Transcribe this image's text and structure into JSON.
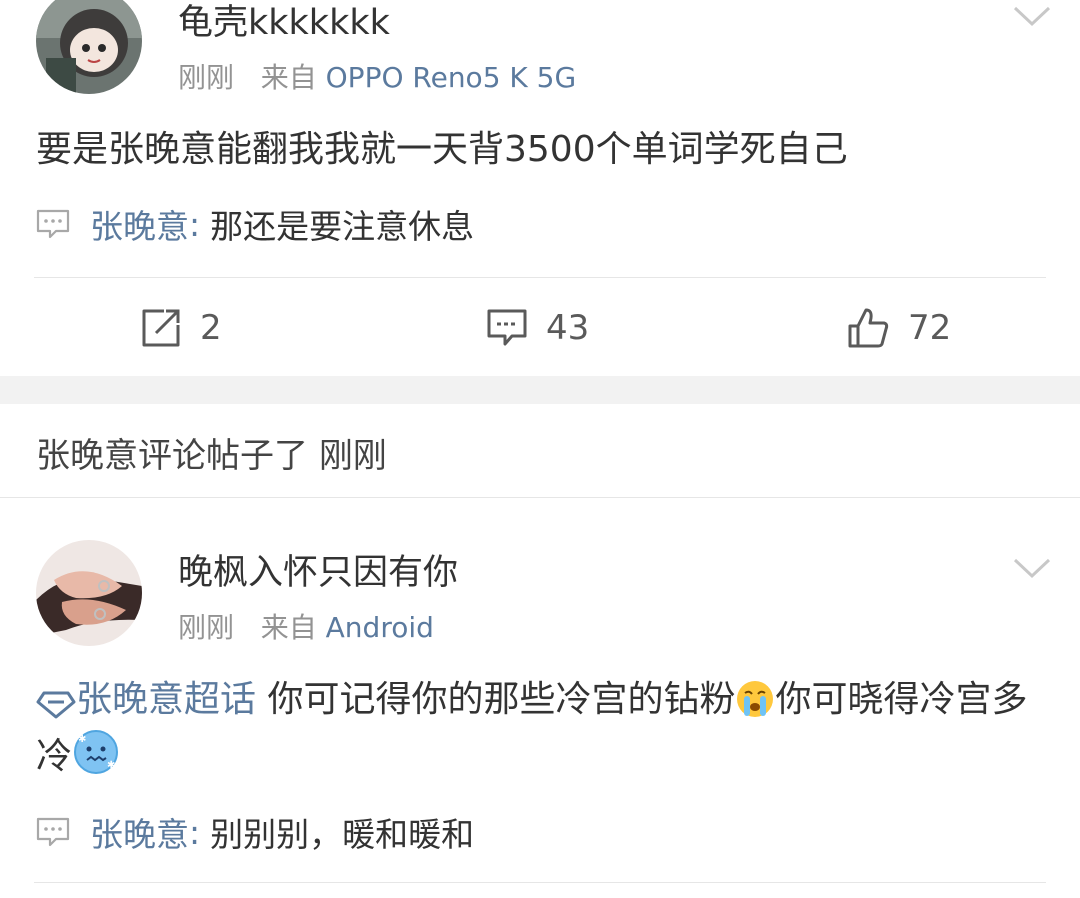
{
  "post1": {
    "username": "龟壳kkkkkkk",
    "time": "刚刚",
    "from_prefix": "来自",
    "source": "OPPO Reno5 K 5G",
    "content": "要是张晚意能翻我我就一天背3500个单词学死自己",
    "reply": {
      "author": "张晚意",
      "colon": ":",
      "text": "那还是要注意休息"
    },
    "actions": {
      "repost": "2",
      "comment": "43",
      "like": "72"
    }
  },
  "notice": {
    "text": "张晚意评论帖子了",
    "time": "刚刚"
  },
  "post2": {
    "username": "晚枫入怀只因有你",
    "time": "刚刚",
    "from_prefix": "来自",
    "source": "Android",
    "topic": "张晚意超话",
    "content_part1": "你可记得你的那些冷宫的钻粉",
    "content_part2": "你可晓得冷宫多冷",
    "reply": {
      "author": "张晚意",
      "colon": ":",
      "text": "别别别，暖和暖和"
    }
  },
  "icons": {
    "dropdown": "chevron-down-icon",
    "repost": "repost-icon",
    "comment": "comment-icon",
    "like": "thumbs-up-icon",
    "reply": "reply-bubble-icon",
    "topic": "super-topic-icon",
    "crying": "crying-emoji-icon",
    "cold": "cold-face-emoji-icon"
  },
  "colors": {
    "link": "#5b7a9e",
    "meta": "#939393",
    "text": "#333333",
    "separator": "#f2f2f2"
  }
}
